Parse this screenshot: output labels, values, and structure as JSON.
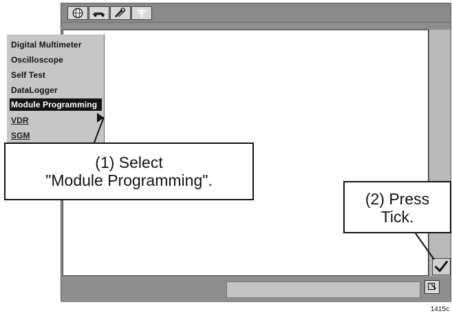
{
  "toolbar": {
    "tools": [
      {
        "icon": "globe-icon"
      },
      {
        "icon": "vehicle-icon"
      },
      {
        "icon": "tools-icon"
      },
      {
        "icon": "antenna-icon"
      }
    ]
  },
  "menu": {
    "items": [
      {
        "label": "Digital Multimeter",
        "state": "normal"
      },
      {
        "label": "Oscilloscope",
        "state": "normal"
      },
      {
        "label": "Self Test",
        "state": "normal"
      },
      {
        "label": "DataLogger",
        "state": "normal"
      },
      {
        "label": "Module Programming",
        "state": "selected"
      },
      {
        "label": "VDR",
        "state": "underlined"
      },
      {
        "label": "SGM",
        "state": "underlined"
      }
    ],
    "selected_color": "#141414",
    "submenu_icon": "submenu-arrow-icon"
  },
  "callouts": {
    "step1_line1": "(1) Select",
    "step1_line2": "\"Module Programming\".",
    "step2_line1": "(2) Press",
    "step2_line2": "Tick."
  },
  "buttons": {
    "tick_icon": "tick-icon",
    "status_icon": "pen-icon"
  },
  "figure_number": "1415c"
}
